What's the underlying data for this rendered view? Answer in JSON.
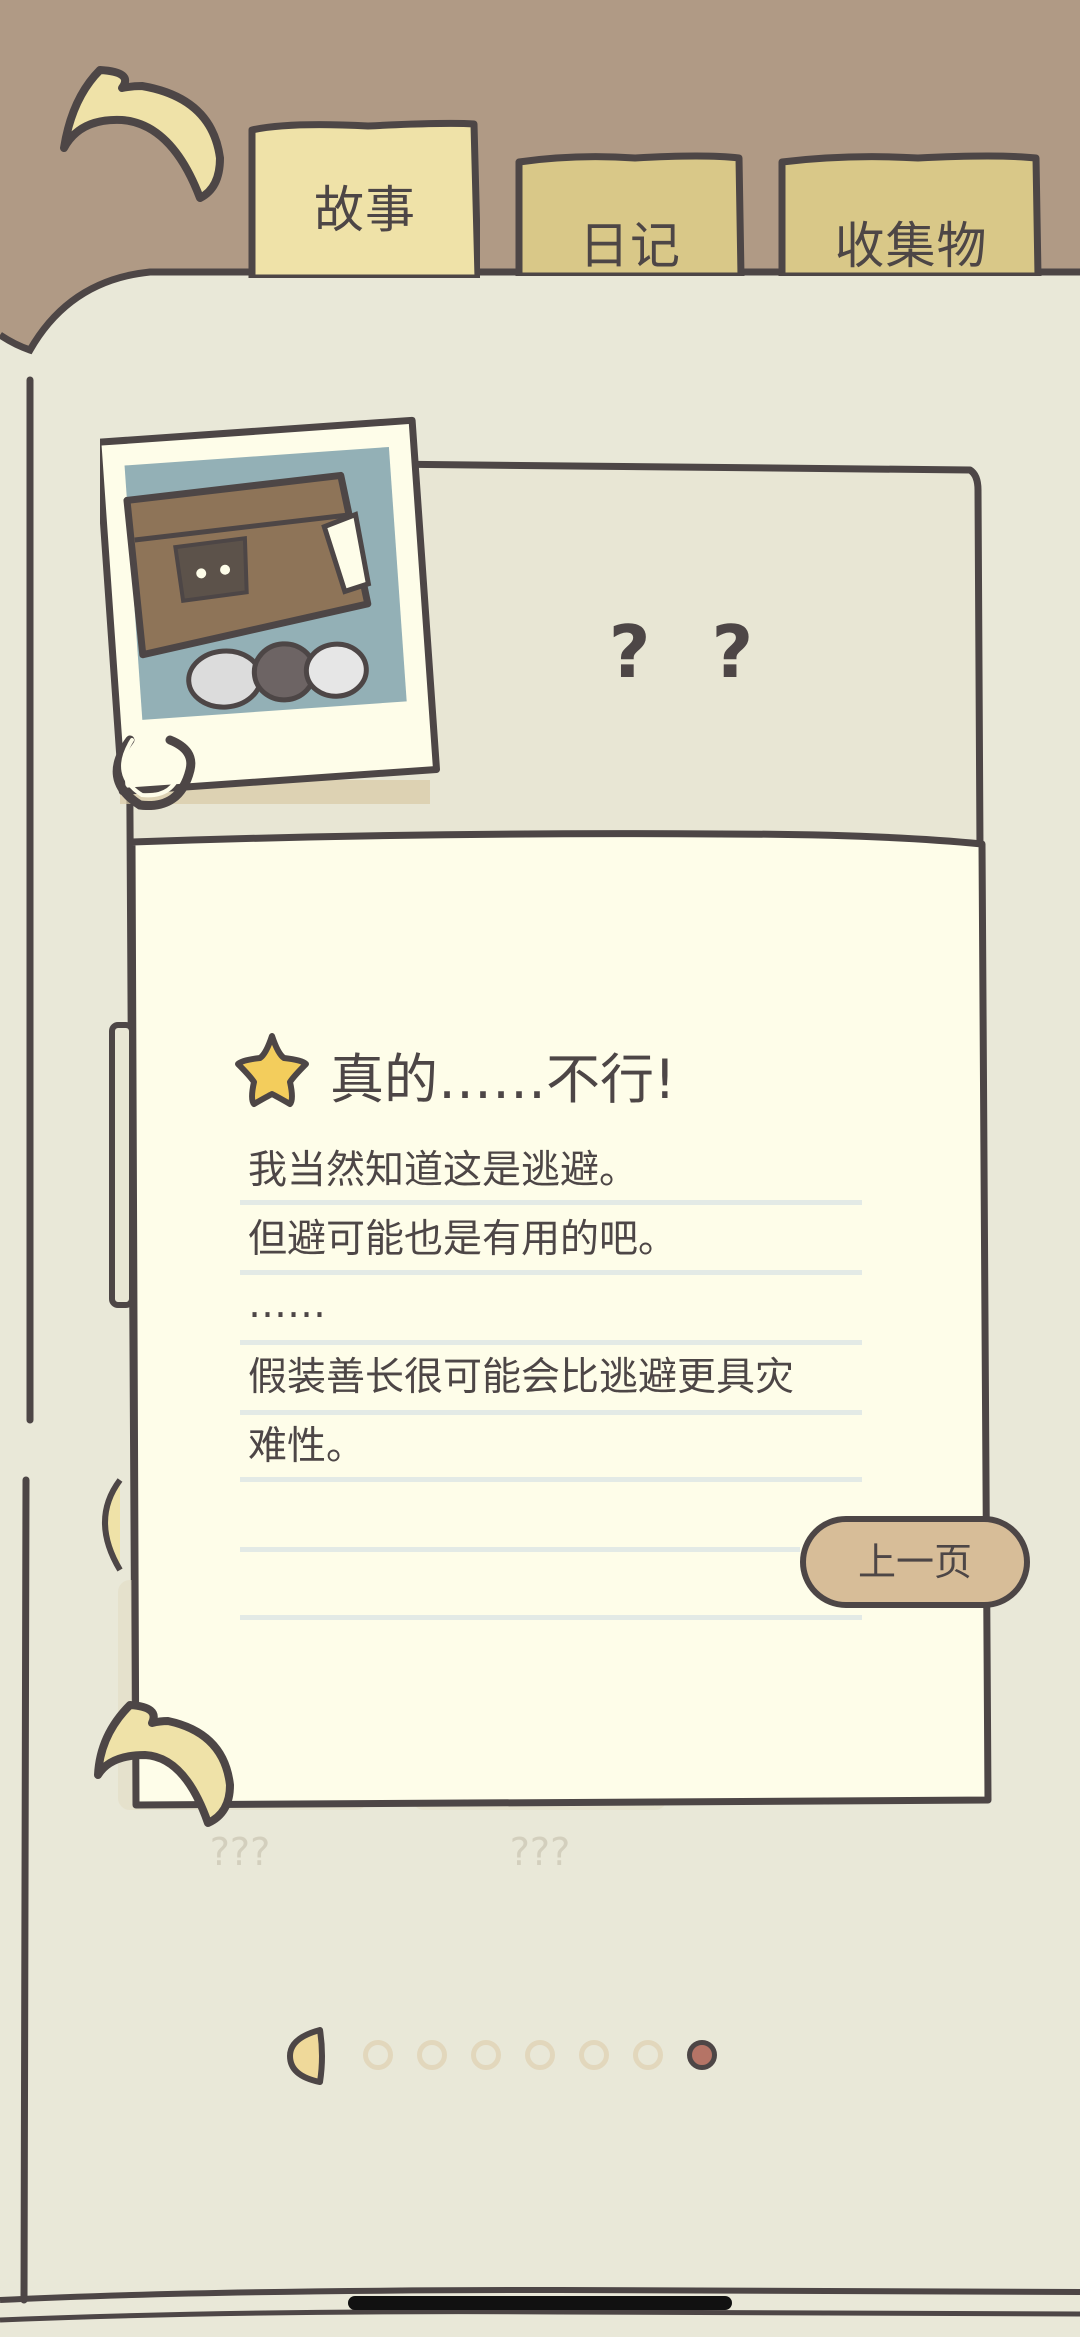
{
  "tabs": [
    {
      "label": "故事",
      "selected": true
    },
    {
      "label": "日记",
      "selected": false
    },
    {
      "label": "收集物",
      "selected": false
    }
  ],
  "story": {
    "unknown_title": "? ?",
    "faded_labels": [
      "???",
      "???"
    ]
  },
  "note": {
    "title": "真的……不行!",
    "lines": [
      "我当然知道这是逃避。",
      "但避可能也是有用的吧。",
      "……",
      "假装善长很可能会比逃避更具灾",
      "难性。"
    ],
    "prev_button_label": "上一页"
  },
  "pagination": {
    "total": 7,
    "current": 7
  },
  "colors": {
    "header_bg": "#b09a85",
    "page_bg": "#e9e8d8",
    "paper": "#fefde9",
    "outline": "#4d4646",
    "tab_fill": "#d9c888",
    "tab_selected_fill": "#efe2a8",
    "button_fill": "#d7bd98",
    "accent_dot": "#b57466",
    "star": "#f3cd5c"
  }
}
